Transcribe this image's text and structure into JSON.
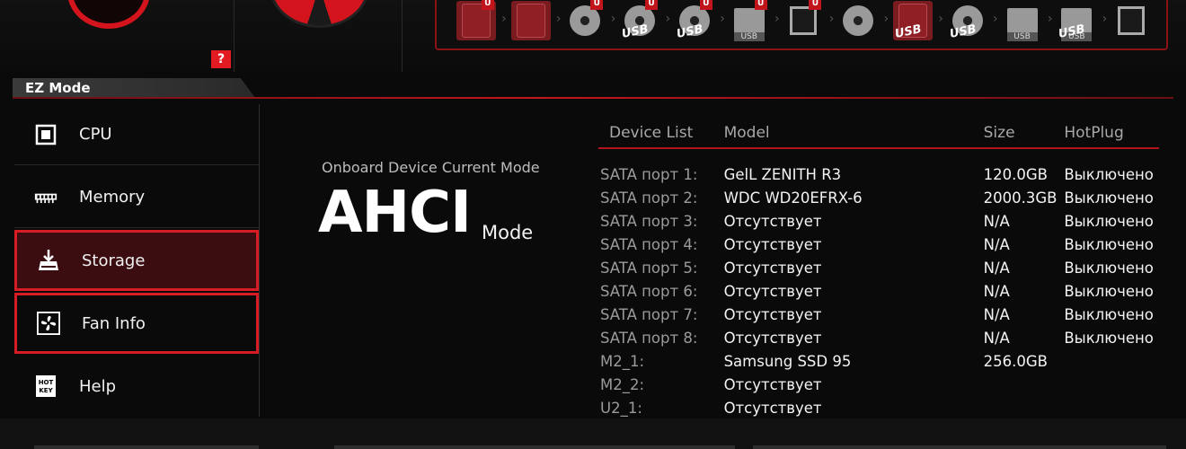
{
  "top": {
    "help_badge": "?",
    "boot_devices": [
      {
        "type": "hdd",
        "uefi": true,
        "tag": "",
        "highlighted": true
      },
      {
        "type": "hdd",
        "uefi": false,
        "tag": "",
        "highlighted": true
      },
      {
        "type": "disc",
        "uefi": true,
        "tag": "",
        "highlighted": false
      },
      {
        "type": "usb-disc",
        "uefi": true,
        "tag": "USB",
        "highlighted": false
      },
      {
        "type": "usb-disc",
        "uefi": true,
        "tag": "USB",
        "highlighted": false
      },
      {
        "type": "usb-drive",
        "uefi": true,
        "tag": "USB",
        "highlighted": false
      },
      {
        "type": "network",
        "uefi": true,
        "tag": "",
        "highlighted": false
      },
      {
        "type": "disc",
        "uefi": false,
        "tag": "",
        "highlighted": false
      },
      {
        "type": "usb-hdd",
        "uefi": false,
        "tag": "USB",
        "highlighted": true
      },
      {
        "type": "usb-disc",
        "uefi": false,
        "tag": "USB",
        "highlighted": false
      },
      {
        "type": "usb-drive",
        "uefi": false,
        "tag": "USB",
        "highlighted": false
      },
      {
        "type": "usb-floppy",
        "uefi": false,
        "tag": "USB",
        "highlighted": false
      },
      {
        "type": "network",
        "uefi": false,
        "tag": "",
        "highlighted": false
      }
    ],
    "uefi_label": "U"
  },
  "ez_mode": {
    "tab_label": "EZ Mode"
  },
  "sidebar": {
    "items": [
      {
        "label": "CPU",
        "icon": "cpu-icon"
      },
      {
        "label": "Memory",
        "icon": "memory-icon"
      },
      {
        "label": "Storage",
        "icon": "storage-icon",
        "state": "active"
      },
      {
        "label": "Fan Info",
        "icon": "fan-icon",
        "state": "focus"
      },
      {
        "label": "Help",
        "icon": "hotkey-icon"
      }
    ],
    "hotkey_icon_text": [
      "HOT",
      "KEY"
    ]
  },
  "storage": {
    "mode_caption": "Onboard Device Current Mode",
    "mode_value": "AHCI",
    "mode_suffix": "Mode",
    "columns": [
      "Device List",
      "Model",
      "Size",
      "HotPlug"
    ],
    "rows": [
      {
        "port": "SATA порт 1:",
        "model": "GelL ZENITH R3",
        "size": "120.0GB",
        "hotplug": "Выключено"
      },
      {
        "port": "SATA порт 2:",
        "model": "WDC WD20EFRX-6",
        "size": "2000.3GB",
        "hotplug": "Выключено"
      },
      {
        "port": "SATA порт 3:",
        "model": "Отсутствует",
        "size": "N/A",
        "hotplug": "Выключено"
      },
      {
        "port": "SATA порт 4:",
        "model": "Отсутствует",
        "size": "N/A",
        "hotplug": "Выключено"
      },
      {
        "port": "SATA порт 5:",
        "model": "Отсутствует",
        "size": "N/A",
        "hotplug": "Выключено"
      },
      {
        "port": "SATA порт 6:",
        "model": "Отсутствует",
        "size": "N/A",
        "hotplug": "Выключено"
      },
      {
        "port": "SATA порт 7:",
        "model": "Отсутствует",
        "size": "N/A",
        "hotplug": "Выключено"
      },
      {
        "port": "SATA порт 8:",
        "model": "Отсутствует",
        "size": "N/A",
        "hotplug": "Выключено"
      },
      {
        "port": "M2_1:",
        "model": "Samsung SSD 95",
        "size": "256.0GB",
        "hotplug": ""
      },
      {
        "port": "M2_2:",
        "model": "Отсутствует",
        "size": "",
        "hotplug": ""
      },
      {
        "port": "U2_1:",
        "model": "Отсутствует",
        "size": "",
        "hotplug": ""
      }
    ]
  },
  "colors": {
    "accent": "#d81c23",
    "background": "#0a0a0a",
    "active_bg": "#3b0d10"
  }
}
